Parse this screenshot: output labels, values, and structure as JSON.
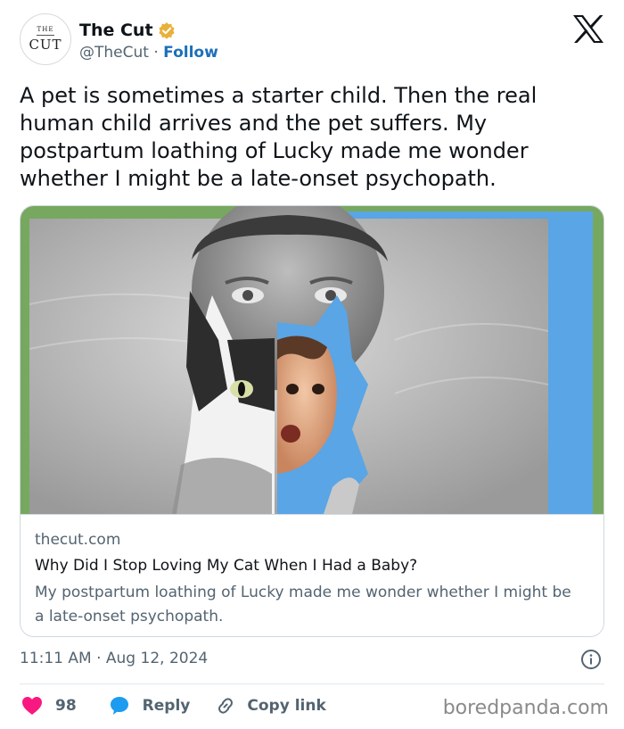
{
  "header": {
    "avatar_top": "THE",
    "avatar_bottom": "CUT",
    "display_name": "The Cut",
    "handle": "@TheCut",
    "separator": "·",
    "follow_label": "Follow"
  },
  "tweet": {
    "text": "A pet is sometimes a starter child. Then the real human child arrives and the pet suffers. My postpartum loathing of Lucky made me wonder whether I might be a late-onset psychopath.",
    "timestamp": "11:11 AM · Aug 12, 2024"
  },
  "card": {
    "domain": "thecut.com",
    "title": "Why Did I Stop Loving My Cat When I Had a Baby?",
    "description": "My postpartum loathing of Lucky made me wonder whether I might be a late-onset psychopath."
  },
  "actions": {
    "like_count": "98",
    "reply_label": "Reply",
    "copy_label": "Copy link"
  },
  "watermark": "boredpanda.com",
  "colors": {
    "verified": "#e8b13a",
    "like": "#f91880",
    "reply": "#1d9bf0",
    "follow": "#1d70b8",
    "card_blue": "#59a5e6",
    "card_green": "#77a85f"
  },
  "icons": [
    "verified-badge-icon",
    "x-logo-icon",
    "heart-icon",
    "reply-bubble-icon",
    "link-icon",
    "info-icon"
  ]
}
